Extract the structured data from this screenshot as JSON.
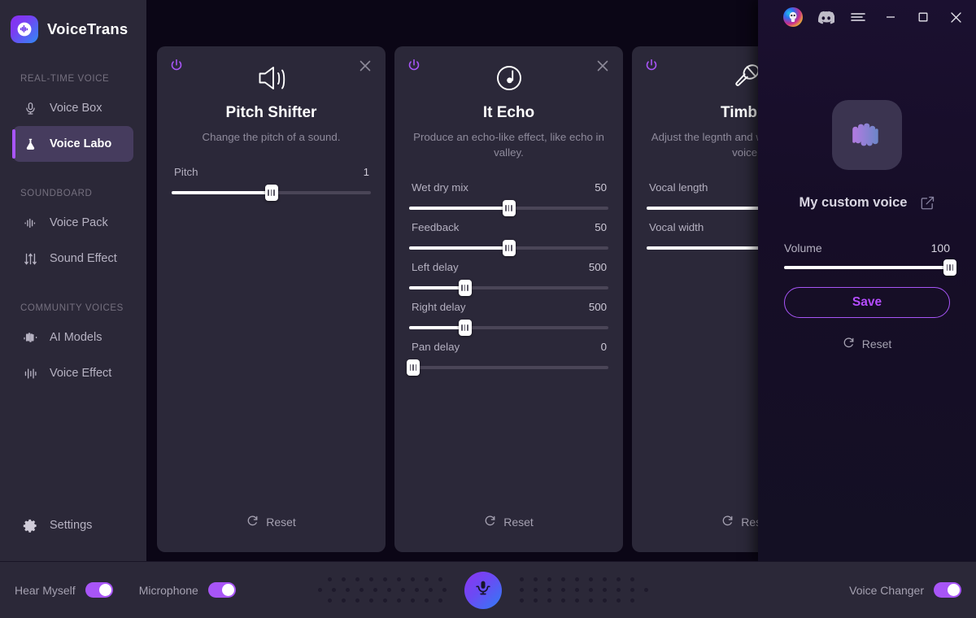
{
  "app": {
    "name": "VoiceTrans",
    "logo_icon": "voicetrans-logo-icon"
  },
  "titlebar": {
    "avatar_name": "user-avatar",
    "buttons": [
      {
        "name": "discord-icon",
        "label": ""
      },
      {
        "name": "menu-icon",
        "label": ""
      },
      {
        "name": "minimize-icon",
        "label": ""
      },
      {
        "name": "maximize-icon",
        "label": ""
      },
      {
        "name": "close-icon",
        "label": ""
      }
    ]
  },
  "sidebar": {
    "sections": [
      {
        "label": "REAL-TIME VOICE",
        "items": [
          {
            "label": "Voice Box",
            "icon": "microphone-icon",
            "active": false
          },
          {
            "label": "Voice Labo",
            "icon": "flask-icon",
            "active": true
          }
        ]
      },
      {
        "label": "SOUNDBOARD",
        "items": [
          {
            "label": "Voice Pack",
            "icon": "waveform-icon",
            "active": false
          },
          {
            "label": "Sound Effect",
            "icon": "sliders-icon",
            "active": false
          }
        ]
      },
      {
        "label": "COMMUNITY VOICES",
        "items": [
          {
            "label": "AI Models",
            "icon": "wave-icon",
            "active": false
          },
          {
            "label": "Voice Effect",
            "icon": "equalizer-icon",
            "active": false
          }
        ]
      }
    ],
    "settings": {
      "label": "Settings",
      "icon": "gear-icon"
    }
  },
  "cards": [
    {
      "id": "pitch-shifter",
      "title": "Pitch Shifter",
      "description": "Change the pitch of a sound.",
      "icon": "speaker-icon",
      "power_icon": "power-icon",
      "close_icon": "close-icon",
      "reset_label": "Reset",
      "sliders": [
        {
          "label": "Pitch",
          "value": "1",
          "percent": 50
        }
      ]
    },
    {
      "id": "it-echo",
      "title": "It Echo",
      "description": "Produce an echo-like effect, like echo in valley.",
      "icon": "echo-note-icon",
      "power_icon": "power-icon",
      "close_icon": "close-icon",
      "reset_label": "Reset",
      "sliders": [
        {
          "label": "Wet dry mix",
          "value": "50",
          "percent": 50
        },
        {
          "label": "Feedback",
          "value": "50",
          "percent": 50
        },
        {
          "label": "Left delay",
          "value": "500",
          "percent": 28
        },
        {
          "label": "Right delay",
          "value": "500",
          "percent": 28
        },
        {
          "label": "Pan delay",
          "value": "0",
          "percent": 2
        }
      ]
    },
    {
      "id": "timbre",
      "title": "Timbre",
      "description": "Adjust the legnth and width tone of your voice.",
      "icon": "microphone-tilt-icon",
      "power_icon": "power-icon",
      "close_icon": "close-icon",
      "reset_label": "Reset",
      "sliders": [
        {
          "label": "Vocal length",
          "value": "",
          "percent": 62
        },
        {
          "label": "Vocal width",
          "value": "",
          "percent": 62
        }
      ]
    }
  ],
  "right_panel": {
    "thumb_icon": "voice-wave-icon",
    "voice_name": "My custom voice",
    "edit_icon": "edit-icon",
    "volume_label": "Volume",
    "volume_value": "100",
    "volume_percent": 100,
    "save_label": "Save",
    "reset_label": "Reset",
    "reset_icon": "refresh-icon",
    "accent_color": "#a855f7",
    "save_text_color": "#b54dff"
  },
  "bottom_bar": {
    "hear_myself": {
      "label": "Hear Myself",
      "on": true
    },
    "microphone": {
      "label": "Microphone",
      "on": true
    },
    "mic_button_icon": "microphone-icon",
    "voice_changer": {
      "label": "Voice Changer",
      "on": true
    }
  },
  "colors": {
    "sidebar_bg": "#2b2838",
    "card_bg": "#2b2839",
    "stage_bg": "#0b0616",
    "accent": "#a855f7",
    "active_nav_bg": "#463c5e"
  }
}
